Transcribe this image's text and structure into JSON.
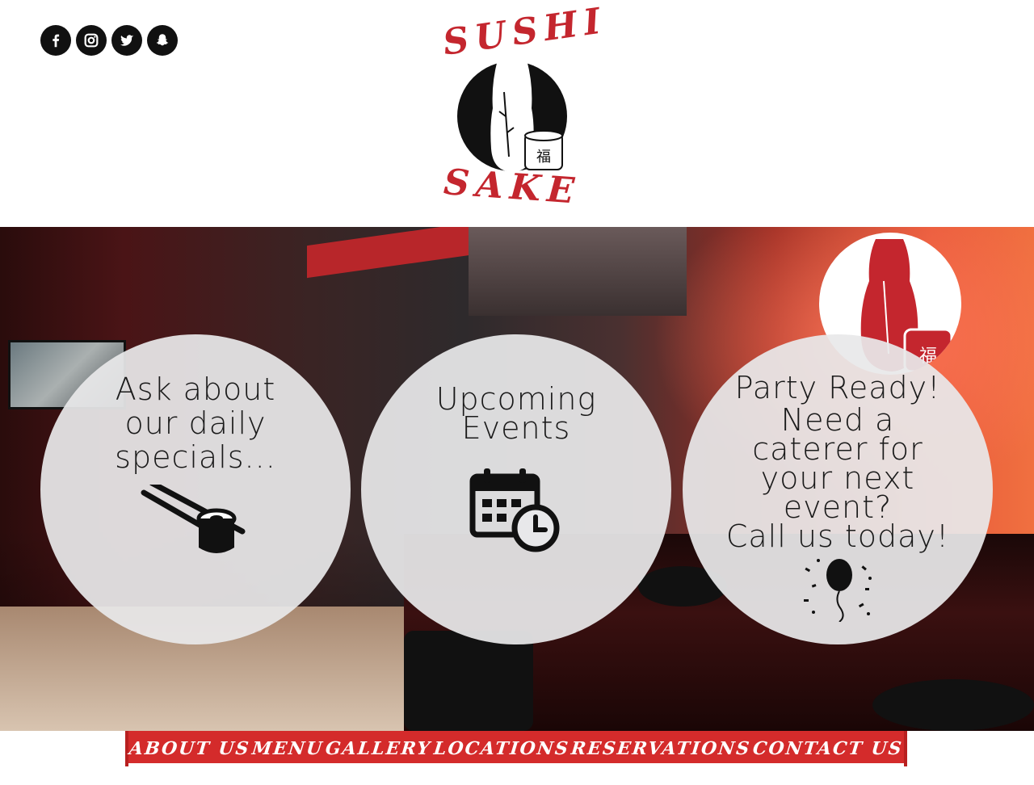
{
  "brand": {
    "top_word": "SUSHI",
    "bottom_word": "SAKE",
    "emblem_glyph": "福",
    "red": "#c4262e"
  },
  "social": [
    {
      "icon": "facebook-icon",
      "glyph": "f"
    },
    {
      "icon": "instagram-icon",
      "glyph": "◎"
    },
    {
      "icon": "twitter-icon",
      "glyph": "bird"
    },
    {
      "icon": "snapchat-icon",
      "glyph": "ghost"
    }
  ],
  "hero": {
    "specials": {
      "text": "Ask about\nour daily\nspecials...",
      "icon": "chopsticks-sushi-icon"
    },
    "events": {
      "text": "Upcoming\nEvents",
      "icon": "calendar-clock-icon"
    },
    "party": {
      "title": "Party Ready!",
      "text": "Need a\ncaterer for\nyour next\nevent?\nCall us today!",
      "icon": "balloon-confetti-icon",
      "badge_glyph": "福"
    }
  },
  "nav": {
    "items": [
      "About Us",
      "Menu",
      "Gallery",
      "Locations",
      "Reservations",
      "Contact Us"
    ],
    "background": "#d42b2b"
  }
}
